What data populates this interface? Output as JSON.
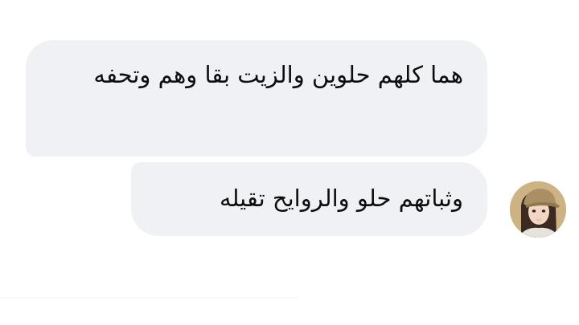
{
  "messages": [
    {
      "text": "هما كلهم حلوين والزيت بقا وهم وتحفه"
    },
    {
      "text": "وثباتهم حلو والروايح تقيله"
    }
  ],
  "avatar": {
    "icon": "profile-avatar-icon"
  },
  "colors": {
    "bubble_bg": "#f0f1f5",
    "text": "#0d0d0d",
    "page_bg": "#ffffff"
  }
}
